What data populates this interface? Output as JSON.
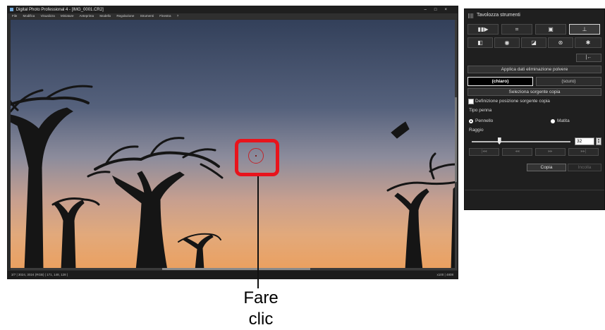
{
  "window": {
    "title": "Digital Photo Professional 4 - [IMG_0001.CR2]",
    "controls": [
      "–",
      "□",
      "×"
    ]
  },
  "menu": [
    "File",
    "Modifica",
    "Visualizza",
    "Miniature",
    "Anteprima",
    "Modello",
    "Regolazione",
    "Strumenti",
    "Finestra",
    "?"
  ],
  "status": {
    "left": "3/7 | 3024, 3024 (RGB) | 171, 148, 128 |",
    "right": "x100 | 4808"
  },
  "callout": {
    "label": "Fare clic",
    "color": "#e8141c"
  },
  "palette": {
    "title": "Tavolozza strumenti",
    "tabs_row1": [
      {
        "icon": "histogram-icon",
        "glyph": "▮▮▶"
      },
      {
        "icon": "crop-icon",
        "glyph": "⌗"
      },
      {
        "icon": "image-adjust-icon",
        "glyph": "▣"
      },
      {
        "icon": "stamp-tool-icon",
        "glyph": "⊥",
        "selected": true
      }
    ],
    "tabs_row2": [
      {
        "icon": "picture-style-icon",
        "glyph": "◧"
      },
      {
        "icon": "lens-correction-icon",
        "glyph": "◉"
      },
      {
        "icon": "tone-curve-icon",
        "glyph": "◪"
      },
      {
        "icon": "color-wheel-icon",
        "glyph": "⊛"
      },
      {
        "icon": "settings-icon",
        "glyph": "✱"
      }
    ],
    "undo_glyph": "|←",
    "apply_dust_label": "Applica dati eliminazione polvere",
    "light_label": "(chiaro)",
    "dark_label": "(scuro)",
    "select_source_label": "Seleziona sorgente copia",
    "define_source_label": "Definizione posizione sorgente copia",
    "pen_type_label": "Tipo penna",
    "brush_label": "Pennello",
    "pencil_label": "Matita",
    "radius_label": "Raggio",
    "radius_value": "32",
    "radius_fraction": 0.28,
    "nav_buttons": [
      "|◂◂",
      "◂◂",
      "▸▸",
      "▸▸|"
    ],
    "copy_label": "Copia",
    "paste_label": "Incolla"
  }
}
